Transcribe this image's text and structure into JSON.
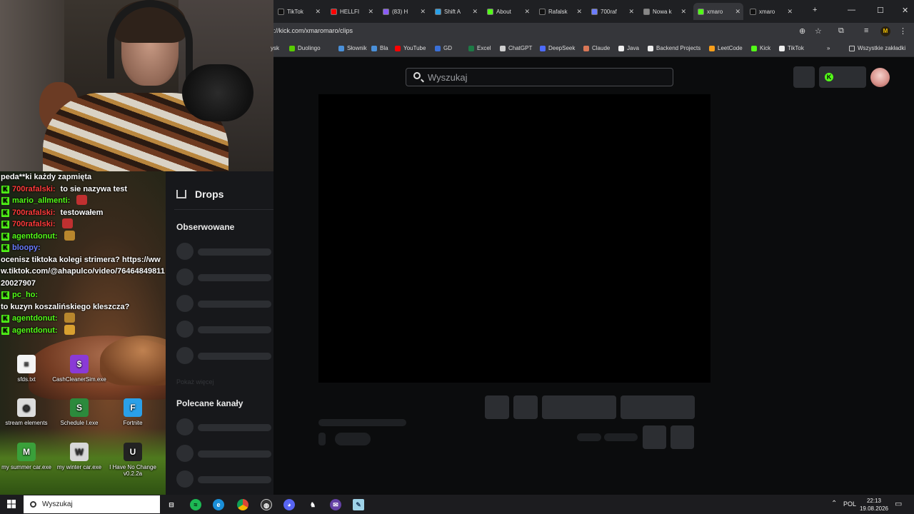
{
  "browser": {
    "tabs": [
      {
        "title": "TikTok",
        "active": false
      },
      {
        "title": "HELLFI",
        "active": false
      },
      {
        "title": "(83) H",
        "active": false
      },
      {
        "title": "Shift A",
        "active": false
      },
      {
        "title": "About",
        "active": false
      },
      {
        "title": "Rafalsk",
        "active": false
      },
      {
        "title": "700raf",
        "active": false
      },
      {
        "title": "Nowa k",
        "active": false
      },
      {
        "title": "xmaro",
        "active": true
      },
      {
        "title": "xmaro",
        "active": false
      }
    ],
    "new_tab": "+",
    "window_controls": {
      "minimize": "—",
      "maximize": "☐",
      "close": "✕"
    },
    "url": "://kick.com/xmaromaro/clips",
    "profile_initial": "M",
    "bookmarks": [
      {
        "label": "ysk",
        "color": "#3b5fa8"
      },
      {
        "label": "Duolingo",
        "color": "#58cc02"
      },
      {
        "label": "Słownik",
        "color": "#4a90d9"
      },
      {
        "label": "Bla",
        "color": "#4a90d9"
      },
      {
        "label": "YouTube",
        "color": "#ff0000"
      },
      {
        "label": "GD",
        "color": "#3a70d8"
      },
      {
        "label": "Excel",
        "color": "#1d7a45"
      },
      {
        "label": "ChatGPT",
        "color": "#cfcfcf"
      },
      {
        "label": "DeepSeek",
        "color": "#4d6bfe"
      },
      {
        "label": "Claude",
        "color": "#d97757"
      },
      {
        "label": "Java",
        "color": "#eeeeee"
      },
      {
        "label": "Backend Projects",
        "color": "#eeeeee"
      },
      {
        "label": "LeetCode",
        "color": "#f89f1b"
      },
      {
        "label": "Kick",
        "color": "#53fc18"
      },
      {
        "label": "TikTok",
        "color": "#eeeeee"
      }
    ],
    "bookmarks_more": "»",
    "all_bookmarks": "Wszystkie zakładki"
  },
  "kick": {
    "search_placeholder": "Wyszukaj",
    "sidebar": {
      "drops_label": "Drops",
      "followed_heading": "Obserwowane",
      "show_more": "Pokaż więcej",
      "recommended_heading": "Polecane kanały"
    }
  },
  "chat": {
    "lines": [
      {
        "user": "",
        "user_color": "#ffffff",
        "text": "peda**ki każdy zapmięta",
        "badge": false,
        "emotes": []
      },
      {
        "user": "700rafalski:",
        "user_color": "#ff3b3b",
        "text": "to sie nazywa test",
        "badge": true,
        "emotes": []
      },
      {
        "user": "mario_allmenti:",
        "user_color": "#53fc18",
        "text": "",
        "badge": true,
        "emotes": [
          "#c03030"
        ]
      },
      {
        "user": "700rafalski:",
        "user_color": "#ff3b3b",
        "text": "testowałem",
        "badge": true,
        "emotes": []
      },
      {
        "user": "700rafalski:",
        "user_color": "#ff3b3b",
        "text": "",
        "badge": true,
        "emotes": [
          "#c03030"
        ]
      },
      {
        "user": "agentdonut:",
        "user_color": "#53fc18",
        "text": "",
        "badge": true,
        "emotes": [
          "#b8862d"
        ]
      },
      {
        "user": "bloopy:",
        "user_color": "#6b7cff",
        "text": "ocenisz tiktoka kolegi strimera? https://www.tiktok.com/@ahapulco/video/7646484981120027907",
        "badge": true,
        "emotes": []
      },
      {
        "user": "pc_ho:",
        "user_color": "#53fc18",
        "text": "to kuzyn koszalińskiego kleszcza?",
        "badge": true,
        "emotes": []
      },
      {
        "user": "agentdonut:",
        "user_color": "#53fc18",
        "text": "",
        "badge": true,
        "emotes": [
          "#b8862d"
        ]
      },
      {
        "user": "agentdonut:",
        "user_color": "#53fc18",
        "text": "",
        "badge": true,
        "emotes": [
          "#d9a030"
        ]
      }
    ]
  },
  "desktop_icons": [
    {
      "label": "sfds.txt",
      "color": "#f4f4f4",
      "glyph": "≡"
    },
    {
      "label": "CashCleanerSim.exe",
      "color": "#8a3ad6",
      "glyph": "$"
    },
    {
      "label": "stream elements",
      "color": "#dddddd",
      "glyph": "◉"
    },
    {
      "label": "Schedule I.exe",
      "color": "#2c8a3c",
      "glyph": "S"
    },
    {
      "label": "Fortnite",
      "color": "#2aa0e8",
      "glyph": "F"
    },
    {
      "label": "my summer car.exe",
      "color": "#3aa03a",
      "glyph": "M"
    },
    {
      "label": "my winter car.exe",
      "color": "#d8d8d8",
      "glyph": "W"
    },
    {
      "label": "I Have No Change v0.2.2a",
      "color": "#222222",
      "glyph": "U"
    }
  ],
  "taskbar": {
    "search_placeholder": "Wyszukaj",
    "language": "POL",
    "time": "22:13",
    "date": "19.08.2026"
  }
}
